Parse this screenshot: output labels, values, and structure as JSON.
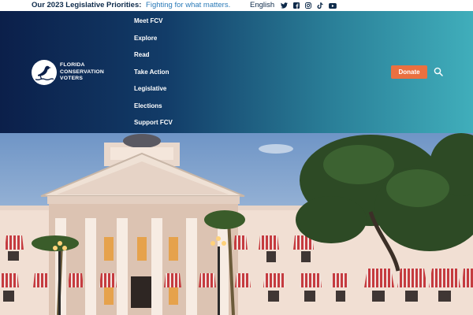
{
  "topbar": {
    "priorities_label": "Our 2023 Legislative Priorities:",
    "priorities_link": "Fighting for what matters.",
    "language": "English",
    "social": [
      "twitter-icon",
      "facebook-icon",
      "instagram-icon",
      "tiktok-icon",
      "youtube-icon"
    ]
  },
  "logo": {
    "line1": "FLORIDA",
    "line2": "CONSERVATION",
    "line3": "VOTERS"
  },
  "nav": {
    "items": [
      "Meet FCV",
      "Explore",
      "Read",
      "Take Action",
      "Legislative",
      "Elections",
      "Support FCV"
    ]
  },
  "actions": {
    "donate_label": "Donate",
    "search_icon": "search-icon"
  },
  "colors": {
    "header_start": "#0b1f4a",
    "header_end": "#40aebb",
    "donate": "#ea7040",
    "link": "#2a7ab8"
  },
  "hero": {
    "image": "photo of a domed capitol building with red-striped awnings and a live oak tree"
  }
}
